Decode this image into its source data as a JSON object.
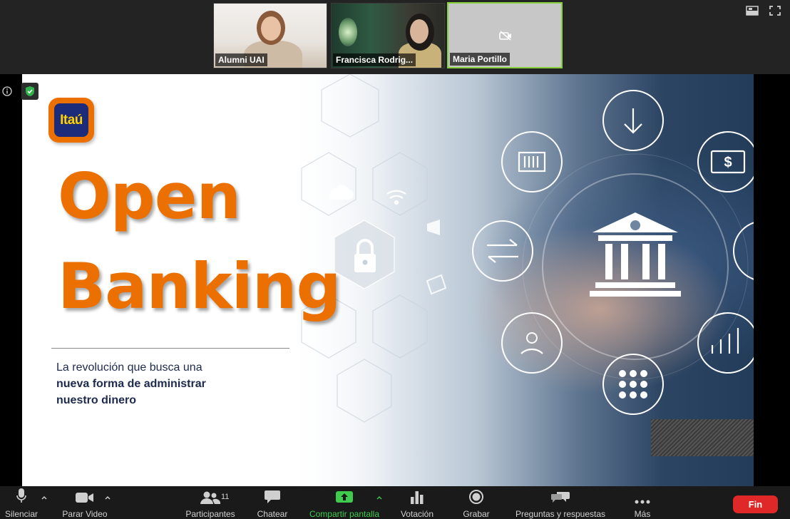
{
  "participants_gallery": [
    {
      "name": "Alumni UAI"
    },
    {
      "name": "Francisca Rodrig..."
    },
    {
      "name": "Maria Portillo"
    }
  ],
  "slide": {
    "logo_text": "Itaú",
    "title_line1": "Open",
    "title_line2": "Banking",
    "subtitle_line1": "La revolución que busca una",
    "subtitle_line2": "nueva forma de administrar",
    "subtitle_line3": "nuestro dinero",
    "accent_color": "#ec7000",
    "logo_bg_color": "#1c2b7a",
    "logo_text_color": "#ffd200"
  },
  "toolbar": {
    "mute_label": "Silenciar",
    "video_label": "Parar Video",
    "participants_label": "Participantes",
    "participants_count": "11",
    "chat_label": "Chatear",
    "share_label": "Compartir pantalla",
    "poll_label": "Votación",
    "record_label": "Grabar",
    "qa_label": "Preguntas y respuestas",
    "more_label": "Más",
    "end_label": "Fin",
    "share_color": "#3ecb4e",
    "end_color": "#e02828"
  }
}
